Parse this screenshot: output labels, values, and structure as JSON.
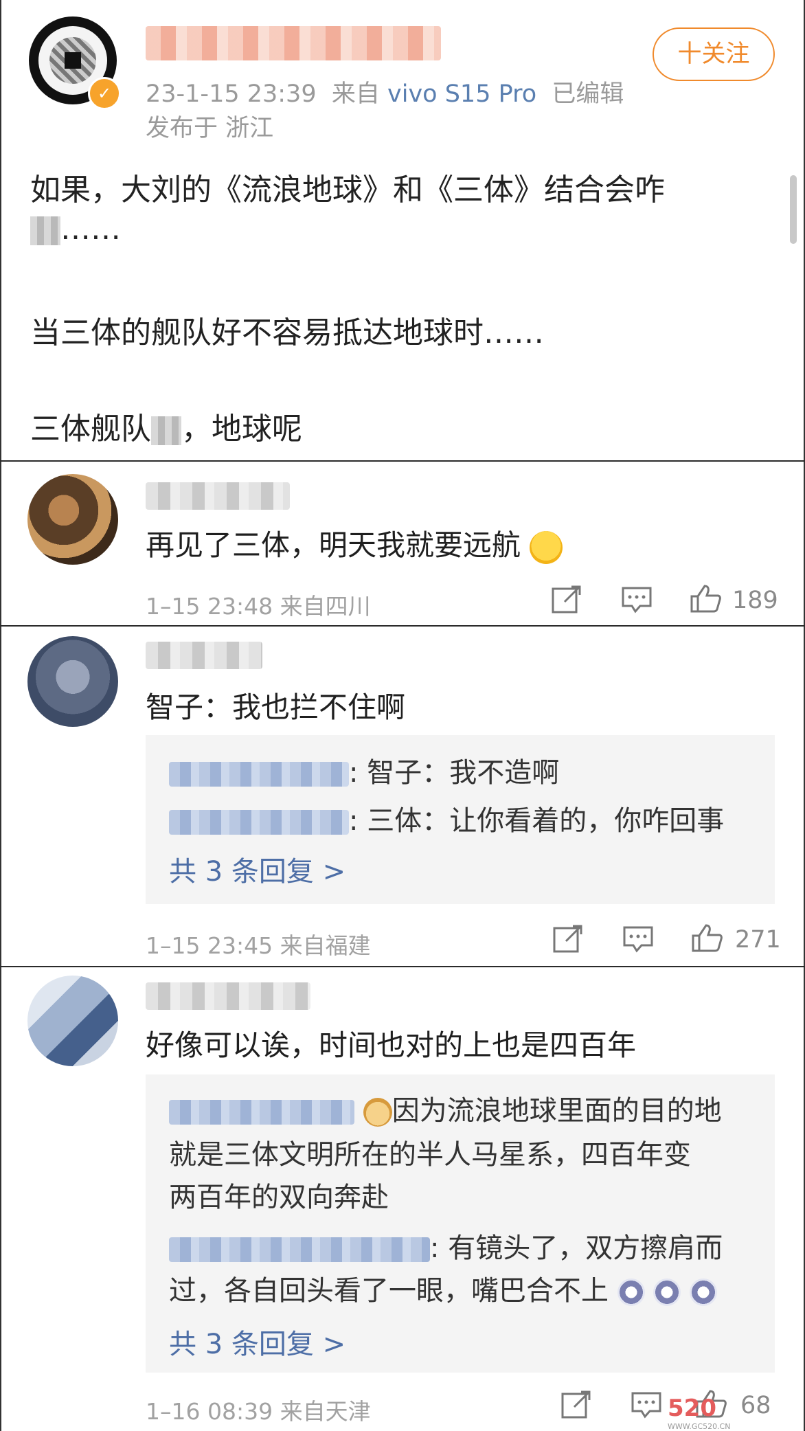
{
  "post": {
    "time": "23-1-15 23:39",
    "source_prefix": "来自",
    "device": "vivo S15 Pro",
    "edited": "已编辑",
    "location": "发布于 浙江",
    "follow_label": "十关注",
    "lines": [
      "如果，大刘的《流浪地球》和《三体》结合会咋",
      "……",
      "当三体的舰队好不容易抵达地球时……",
      "三体舰队",
      "，地球呢"
    ]
  },
  "comments": [
    {
      "text": "再见了三体，明天我就要远航",
      "time": "1–15 23:48",
      "location": "来自四川",
      "likes": "189",
      "replies": []
    },
    {
      "text": "智子：我也拦不住啊",
      "time": "1–15 23:45",
      "location": "来自福建",
      "likes": "271",
      "replies": [
        ": 智子：我不造啊",
        ": 三体：让你看着的，你咋回事"
      ],
      "more_replies": "共 3 条回复 >"
    },
    {
      "text": "好像可以诶，时间也对的上也是四百年",
      "time": "1–16 08:39",
      "location": "来自天津",
      "likes": "68",
      "replies": [
        "因为流浪地球里面的目的地",
        "就是三体文明所在的半人马星系，四百年变",
        "两百年的双向奔赴",
        ": 有镜头了，双方擦肩而",
        "过，各自回头看了一眼，嘴巴合不上"
      ],
      "more_replies": "共 3 条回复 >"
    }
  ],
  "watermark": "520",
  "watermark_site": "WWW.GC520.CN",
  "colors": {
    "accent": "#f08a2c",
    "link": "#4d6ea6",
    "meta": "#a2a2a2"
  }
}
